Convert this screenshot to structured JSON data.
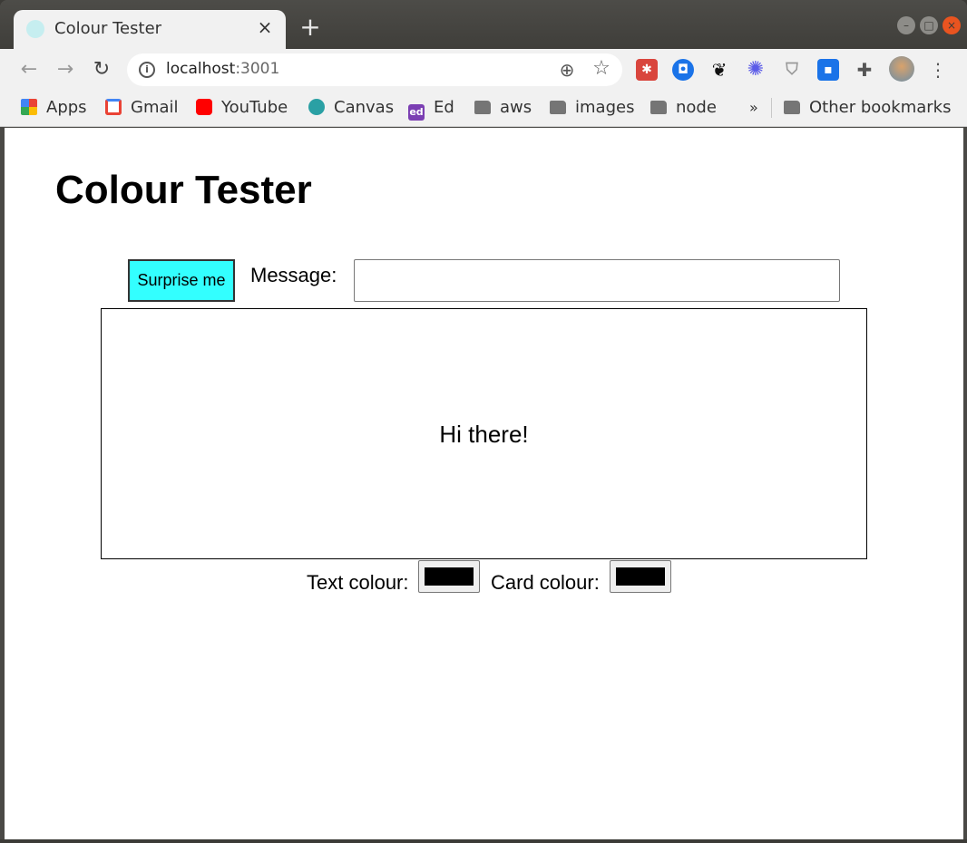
{
  "browser": {
    "tab": {
      "title": "Colour Tester",
      "close": "×"
    },
    "new_tab": "+",
    "window_controls": {
      "minimize": "–",
      "maximize": "□",
      "close": "×"
    },
    "toolbar": {
      "back": "←",
      "forward": "→",
      "reload": "↻",
      "url_host": "localhost",
      "url_port": ":3001",
      "zoom_icon": "⊕",
      "star_icon": "☆",
      "menu": "⋮",
      "extensions": [
        "ext-red",
        "ext-blue",
        "ext-paw",
        "ext-gear",
        "ext-shield",
        "ext-blue-badge",
        "puzzle-icon"
      ]
    },
    "bookmarks": {
      "items": [
        {
          "label": "Apps",
          "icon": "apps-icon"
        },
        {
          "label": "Gmail",
          "icon": "gmail-icon"
        },
        {
          "label": "YouTube",
          "icon": "youtube-icon"
        },
        {
          "label": "Canvas",
          "icon": "canvas-icon"
        },
        {
          "label": "Ed",
          "icon": "ed-icon"
        },
        {
          "label": "aws",
          "icon": "folder-icon"
        },
        {
          "label": "images",
          "icon": "folder-icon"
        },
        {
          "label": "node",
          "icon": "folder-icon"
        }
      ],
      "overflow": "»",
      "other": "Other bookmarks"
    }
  },
  "page": {
    "title": "Colour Tester",
    "surprise_button": "Surprise me",
    "message_label": "Message:",
    "message_value": "",
    "card_text": "Hi there!",
    "text_colour_label": "Text colour:",
    "card_colour_label": "Card colour:",
    "text_colour_value": "#000000",
    "card_colour_value": "#000000",
    "accent_colors": {
      "button": "#33ffff"
    }
  }
}
